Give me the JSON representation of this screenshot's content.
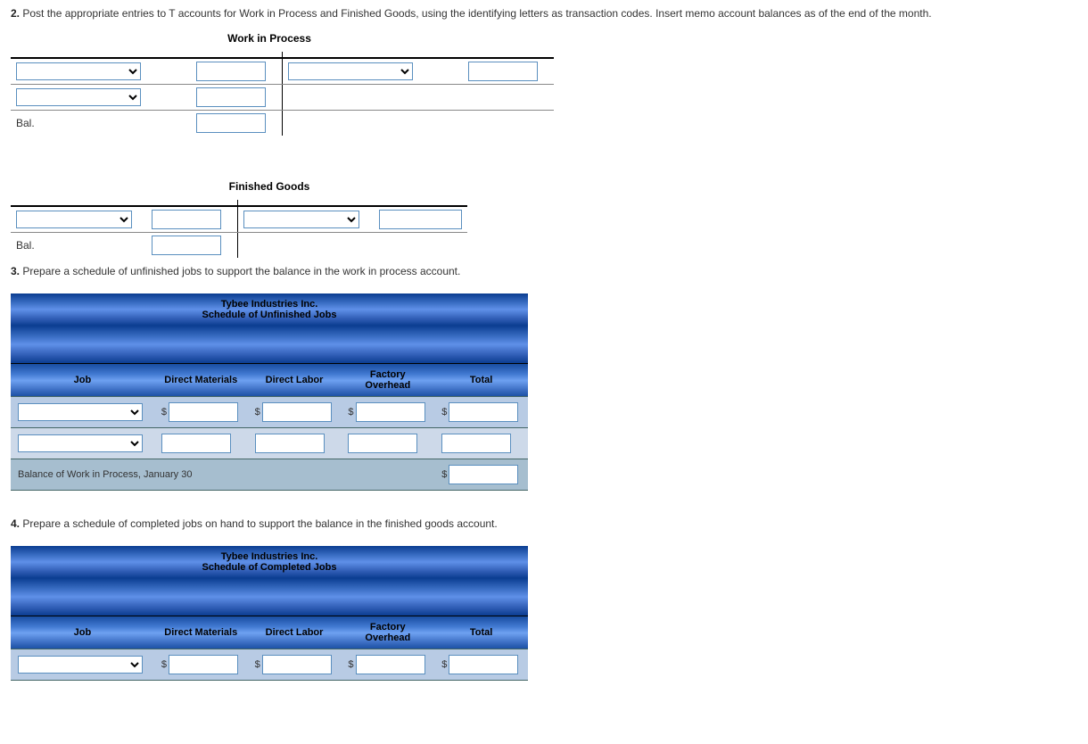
{
  "q2": {
    "num": "2.",
    "text": "Post the appropriate entries to T accounts for Work in Process and Finished Goods, using the identifying letters as transaction codes. Insert memo account balances as of the end of the month."
  },
  "wip": {
    "title": "Work in Process",
    "balLabel": "Bal."
  },
  "fg": {
    "title": "Finished Goods",
    "balLabel": "Bal."
  },
  "q3": {
    "num": "3.",
    "text": "Prepare a schedule of unfinished jobs to support the balance in the work in process account."
  },
  "schedule1": {
    "company": "Tybee Industries Inc.",
    "title": "Schedule of Unfinished Jobs",
    "cols": {
      "job": "Job",
      "dm": "Direct Materials",
      "dl": "Direct Labor",
      "foh": "Factory Overhead",
      "total": "Total"
    },
    "balanceRow": "Balance of Work in Process, January 30",
    "dollar": "$"
  },
  "q4": {
    "num": "4.",
    "text": "Prepare a schedule of completed jobs on hand to support the balance in the finished goods account."
  },
  "schedule2": {
    "company": "Tybee Industries Inc.",
    "title": "Schedule of Completed Jobs",
    "cols": {
      "job": "Job",
      "dm": "Direct Materials",
      "dl": "Direct Labor",
      "foh": "Factory Overhead",
      "total": "Total"
    },
    "dollar": "$"
  }
}
